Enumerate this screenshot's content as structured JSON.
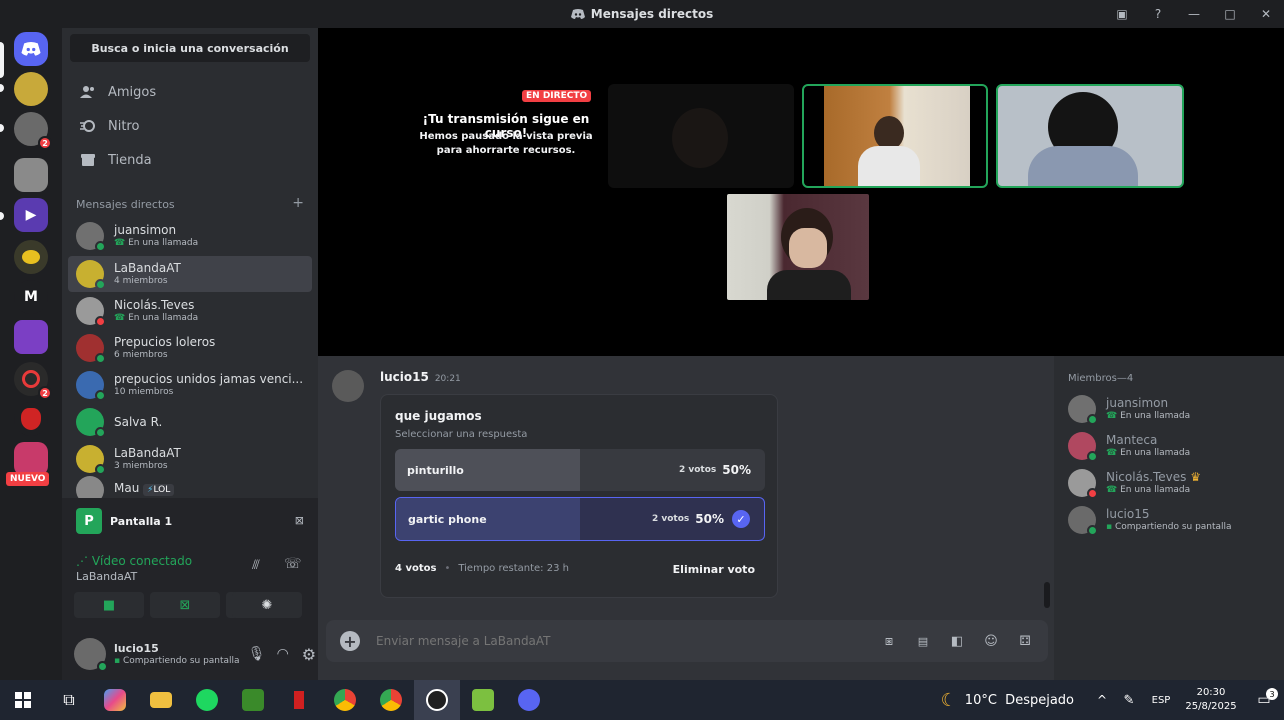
{
  "titlebar": {
    "title": "Mensajes directos"
  },
  "sidebar": {
    "search": "Busca o inicia una conversación",
    "nav": [
      {
        "label": "Amigos",
        "icon": "friends-icon"
      },
      {
        "label": "Nitro",
        "icon": "nitro-icon"
      },
      {
        "label": "Tienda",
        "icon": "shop-icon"
      }
    ],
    "dm_header": "Mensajes directos",
    "dm_add": "+",
    "dms": [
      {
        "name": "juansimon",
        "sub": "En una llamada",
        "status": "online"
      },
      {
        "name": "LaBandaAT",
        "sub": "4 miembros",
        "status": "group"
      },
      {
        "name": "Nicolás.Teves",
        "sub": "En una llamada",
        "status": "dnd"
      },
      {
        "name": "Prepucios loleros",
        "sub": "6 miembros",
        "status": "group"
      },
      {
        "name": "prepucios unidos jamas venci...",
        "sub": "10 miembros",
        "status": "group"
      },
      {
        "name": "Salva R.",
        "sub": "",
        "status": "online"
      },
      {
        "name": "LaBandaAT",
        "sub": "3 miembros",
        "status": "group"
      },
      {
        "name": "Mau",
        "sub": "",
        "status": "online"
      }
    ],
    "mau_badge": "LOL"
  },
  "servers": {
    "nuevo": "NUEVO",
    "m_label": "M",
    "badge_2": "2"
  },
  "voice": {
    "screen_label": "Pantalla 1",
    "status": "Vídeo conectado",
    "channel": "LaBandaAT"
  },
  "user": {
    "name": "lucio15",
    "status": "Compartiendo su pantalla"
  },
  "stage": {
    "live_badge": "EN DIRECTO",
    "title": "¡Tu transmisión sigue en curso!",
    "desc": "Hemos pausado la vista previa para ahorrarte recursos."
  },
  "message": {
    "author": "lucio15",
    "time": "20:21"
  },
  "poll": {
    "question": "que jugamos",
    "hint": "Seleccionar una respuesta",
    "options": [
      {
        "label": "pinturillo",
        "votes": "2 votos",
        "pct": "50%",
        "fraction": 0.5,
        "selected": false
      },
      {
        "label": "gartic phone",
        "votes": "2 votos",
        "pct": "50%",
        "fraction": 0.5,
        "selected": true
      }
    ],
    "total": "4 votos",
    "dot": "•",
    "remaining": "Tiempo restante: 23 h",
    "remove": "Eliminar voto"
  },
  "composer": {
    "placeholder": "Enviar mensaje a LaBandaAT"
  },
  "members": {
    "header": "Miembros—4",
    "list": [
      {
        "name": "juansimon",
        "sub": "En una llamada"
      },
      {
        "name": "Manteca",
        "sub": "En una llamada"
      },
      {
        "name": "Nicolás.Teves",
        "sub": "En una llamada"
      },
      {
        "name": "lucio15",
        "sub": "Compartiendo su pantalla"
      }
    ]
  },
  "taskbar": {
    "weather": "10°C  Despejado",
    "lang": "ESP",
    "time": "20:30",
    "date": "25/8/2025",
    "notif": "3"
  },
  "colors": {
    "accent": "#5865f2",
    "green": "#23a55a",
    "red": "#f23f43"
  }
}
